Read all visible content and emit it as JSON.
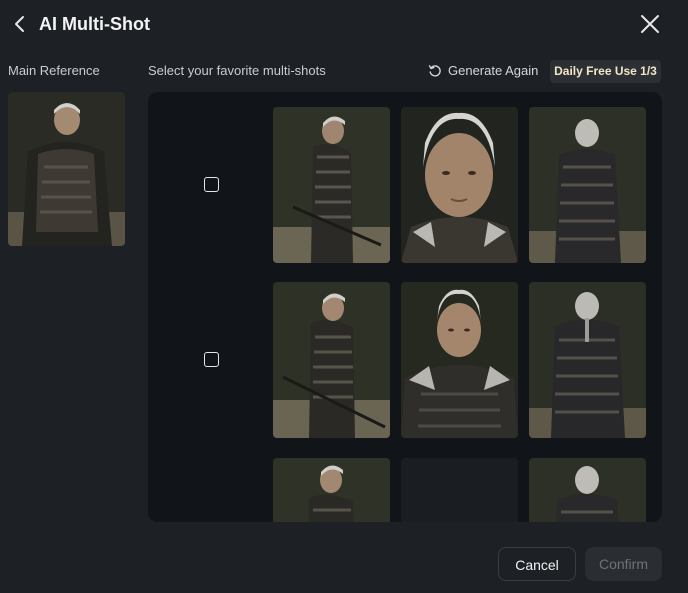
{
  "header": {
    "title": "AI Multi-Shot",
    "back_icon": "chevron-left-icon",
    "close_icon": "close-icon"
  },
  "left": {
    "label": "Main Reference"
  },
  "main": {
    "subtitle": "Select your favorite multi-shots",
    "generate_again": {
      "label": "Generate Again",
      "icon": "refresh-icon"
    },
    "quota_badge": "Daily Free Use 1/3",
    "rows": [
      {
        "shots": [
          "profile-side",
          "portrait-closeup",
          "back-view"
        ]
      },
      {
        "shots": [
          "profile-side",
          "front-medium",
          "back-view"
        ]
      },
      {
        "shots": [
          "profile-side",
          "empty",
          "back-view"
        ]
      }
    ]
  },
  "footer": {
    "cancel_label": "Cancel",
    "confirm_label": "Confirm"
  },
  "colors": {
    "background": "#1d2024",
    "panel": "#111418",
    "badge_text": "#f1e6c8",
    "confirm_disabled": "#2a2d31"
  }
}
